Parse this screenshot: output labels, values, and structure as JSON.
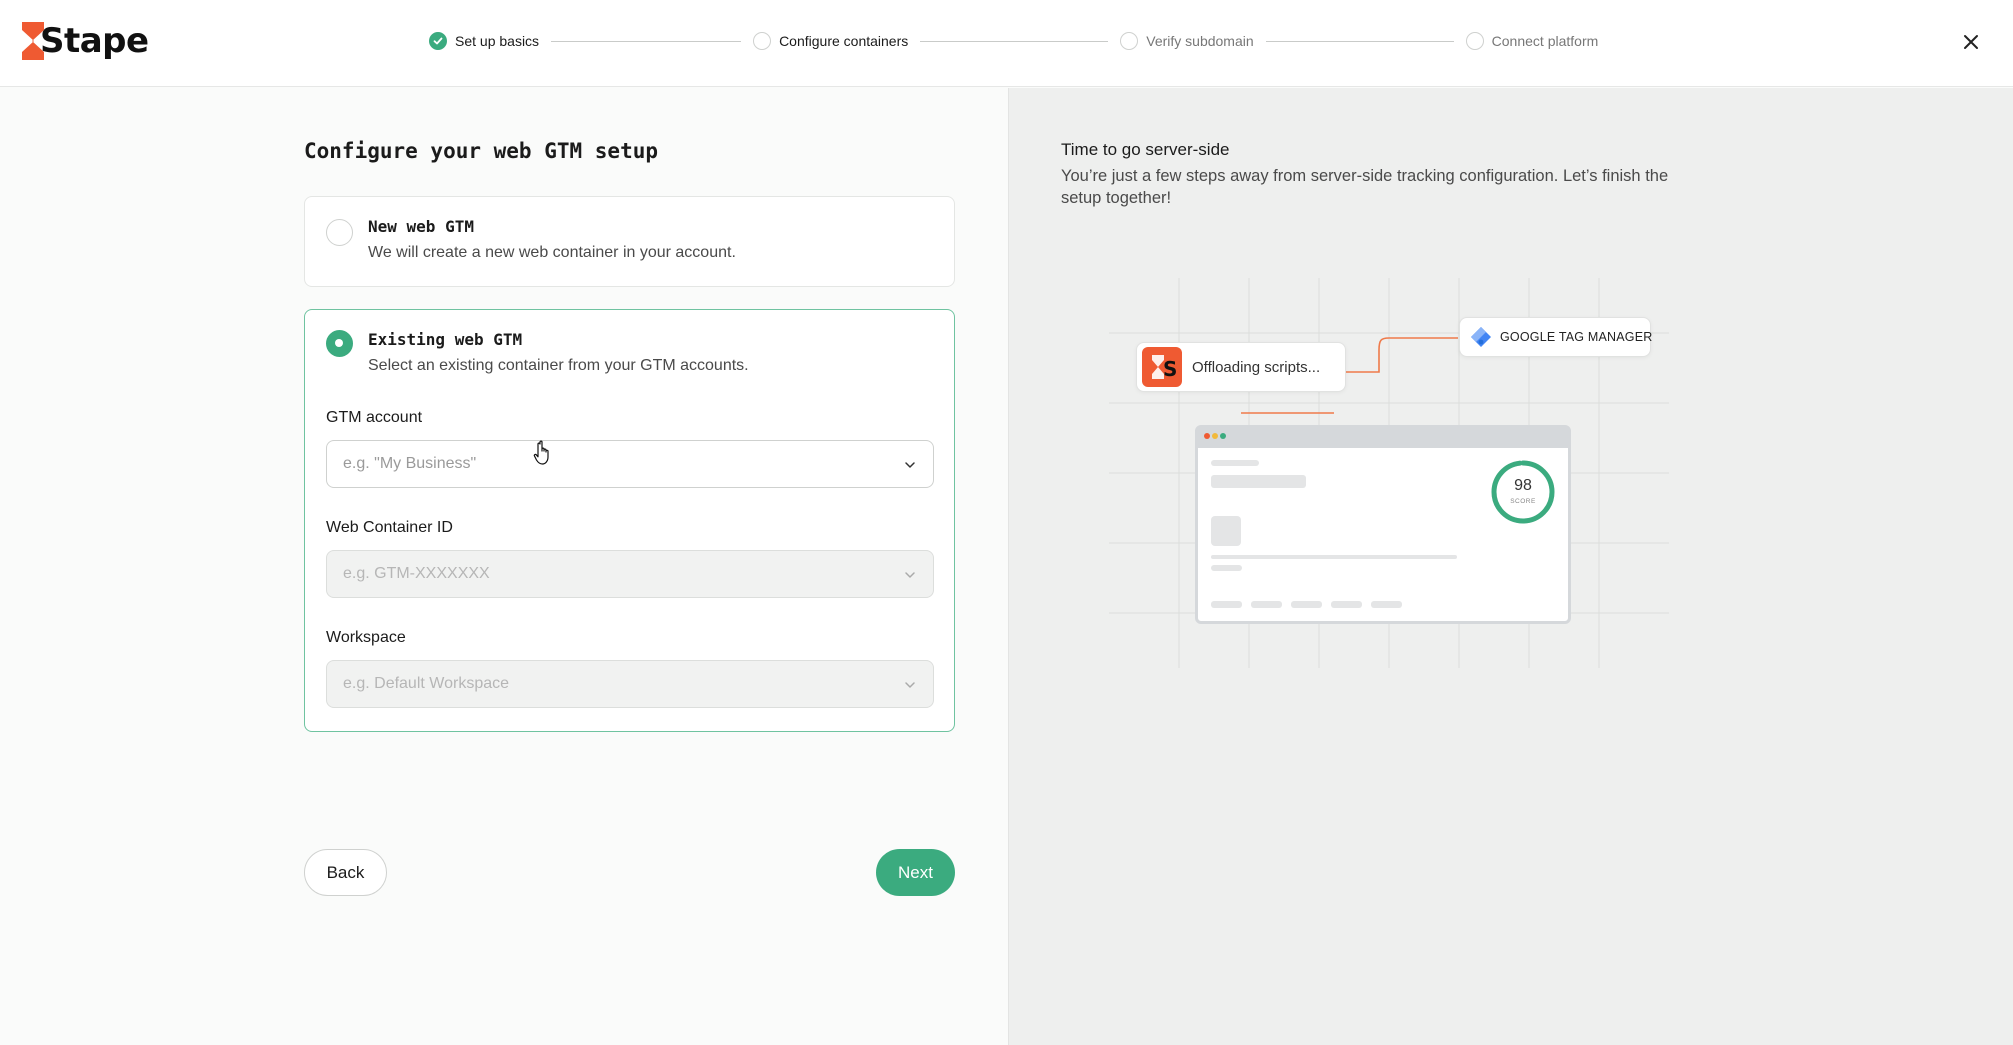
{
  "header": {
    "logo_text": "Stape",
    "steps": [
      {
        "label": "Set up basics",
        "status": "done"
      },
      {
        "label": "Configure containers",
        "status": "current"
      },
      {
        "label": "Verify subdomain",
        "status": "upcoming"
      },
      {
        "label": "Connect platform",
        "status": "upcoming"
      }
    ],
    "close_icon": "close-icon"
  },
  "main": {
    "title": "Configure your web GTM setup",
    "options": [
      {
        "title": "New web GTM",
        "description": "We will create a new web container in your account.",
        "selected": false
      },
      {
        "title": "Existing web GTM",
        "description": "Select an existing container from your GTM accounts.",
        "selected": true
      }
    ],
    "fields": {
      "gtm_account": {
        "label": "GTM account",
        "placeholder": "e.g. \"My Business\"",
        "disabled": false
      },
      "web_container": {
        "label": "Web Container ID",
        "placeholder": "e.g. GTM-XXXXXXX",
        "disabled": true
      },
      "workspace": {
        "label": "Workspace",
        "placeholder": "e.g. Default Workspace",
        "disabled": true
      }
    },
    "back_label": "Back",
    "next_label": "Next"
  },
  "aside": {
    "title": "Time to go server-side",
    "description": "You’re just a few steps away from server-side tracking configuration. Let’s finish the setup together!",
    "illustration": {
      "stape_label": "Offloading scripts...",
      "gtm_label": "GOOGLE TAG MANAGER",
      "score_value": "98",
      "score_label": "SCORE"
    }
  },
  "colors": {
    "accent": "#3bab7f",
    "brand_orange": "#ef5a32",
    "panel_bg": "#eeefee"
  }
}
